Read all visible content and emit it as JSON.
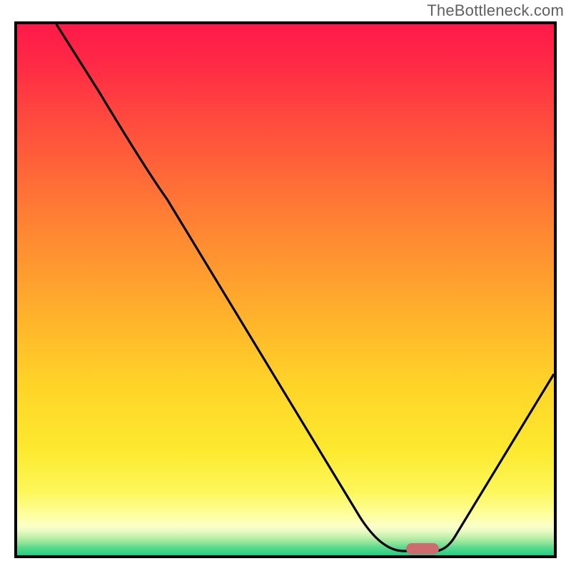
{
  "watermark": "TheBottleneck.com",
  "chart_data": {
    "type": "line",
    "title": "",
    "xlabel": "",
    "ylabel": "",
    "xlim": [
      0,
      100
    ],
    "ylim": [
      0,
      100
    ],
    "grid": false,
    "series": [
      {
        "name": "bottleneck-curve",
        "x": [
          7,
          15,
          28,
          64,
          72,
          78,
          81,
          100
        ],
        "y": [
          100,
          87,
          67,
          7,
          1,
          1,
          3,
          34
        ]
      }
    ],
    "marker": {
      "name": "optimal-range",
      "x_range": [
        72.5,
        78.5
      ],
      "y": 1,
      "color": "#cf6a6e"
    },
    "background_gradient_stops": [
      {
        "pos": 0.0,
        "color": "#ff1a49"
      },
      {
        "pos": 0.3,
        "color": "#ff6d37"
      },
      {
        "pos": 0.68,
        "color": "#ffd428"
      },
      {
        "pos": 0.88,
        "color": "#fdf75a"
      },
      {
        "pos": 0.95,
        "color": "#e8fac3"
      },
      {
        "pos": 1.0,
        "color": "#1ccf82"
      }
    ]
  }
}
